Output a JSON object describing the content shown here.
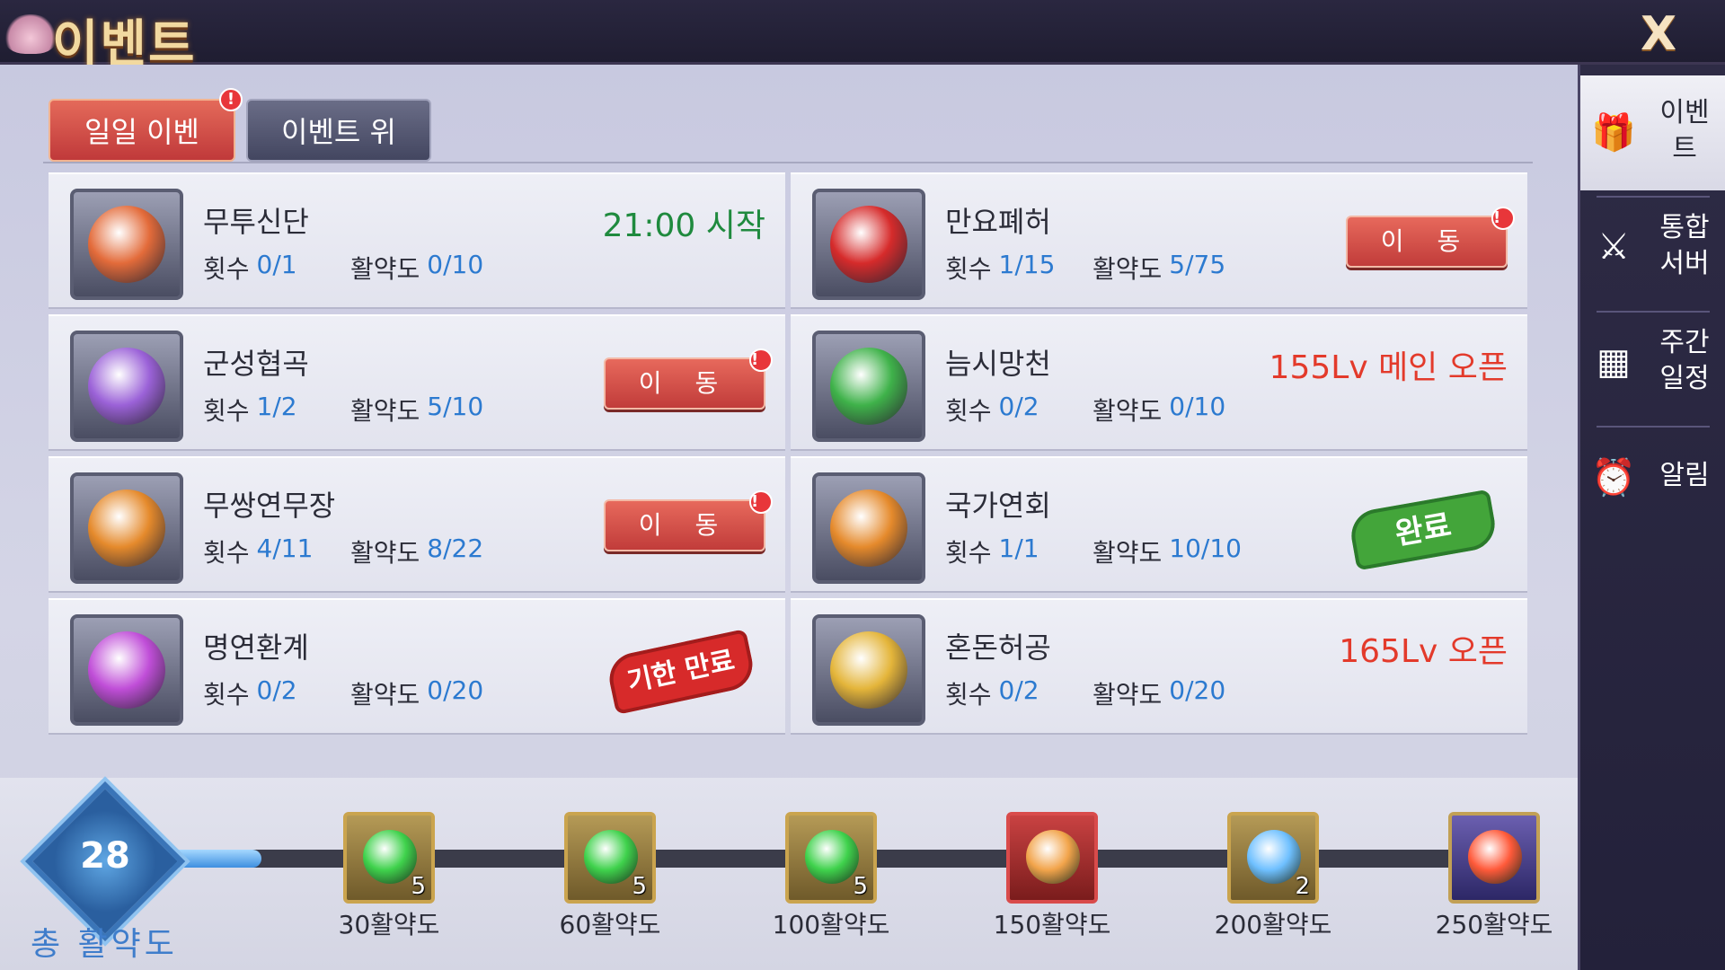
{
  "header": {
    "title": "이벤트",
    "close_label": "X"
  },
  "tabs": [
    {
      "label": "일일 이벤트",
      "badge": "!"
    },
    {
      "label": "이벤트 위탁"
    }
  ],
  "labels": {
    "count": "횟수",
    "activity": "활약도"
  },
  "events": [
    {
      "name": "무투신단",
      "count": "0/1",
      "activity": "0/10",
      "status": "21:00 시작",
      "status_type": "green",
      "icon": "crystal-fire-icon",
      "color": "#e36b3a"
    },
    {
      "name": "만요폐허",
      "count": "1/15",
      "activity": "5/75",
      "status": "이 동",
      "status_type": "button",
      "badge": "!",
      "icon": "phoenix-icon",
      "color": "#d62b2b"
    },
    {
      "name": "군성협곡",
      "count": "1/2",
      "activity": "5/10",
      "status": "이 동",
      "status_type": "button",
      "badge": "!",
      "icon": "paw-orb-icon",
      "color": "#9b62d8"
    },
    {
      "name": "늠시망천",
      "count": "0/2",
      "activity": "0/10",
      "status": "155Lv 메인 오픈",
      "status_type": "red",
      "icon": "green-orb-icon",
      "color": "#3fb24a"
    },
    {
      "name": "무쌍연무장",
      "count": "4/11",
      "activity": "8/22",
      "status": "이 동",
      "status_type": "button",
      "badge": "!",
      "icon": "crest-icon",
      "color": "#e58a2c"
    },
    {
      "name": "국가연회",
      "count": "1/1",
      "activity": "10/10",
      "status": "완료",
      "status_type": "done",
      "icon": "crest-icon",
      "color": "#e58a2c"
    },
    {
      "name": "명연환계",
      "count": "0/2",
      "activity": "0/20",
      "status": "기한 만료",
      "status_type": "expired",
      "icon": "purple-egg-icon",
      "color": "#c04ed8"
    },
    {
      "name": "혼돈허공",
      "count": "0/2",
      "activity": "0/20",
      "status": "165Lv 오픈",
      "status_type": "red",
      "icon": "exp-icon",
      "color": "#e4b53a"
    }
  ],
  "progress": {
    "total_label": "총 활약도",
    "value": "28",
    "fill_fraction": 0.112,
    "rewards": [
      {
        "label": "30활약도",
        "count": "5",
        "icon": "green-gem-icon",
        "style": "gold"
      },
      {
        "label": "60활약도",
        "count": "5",
        "icon": "green-gem-icon",
        "style": "gold"
      },
      {
        "label": "100활약도",
        "count": "5",
        "icon": "green-gem-icon",
        "style": "gold"
      },
      {
        "label": "150활약도",
        "count": "",
        "icon": "scroll-icon",
        "style": "red"
      },
      {
        "label": "200활약도",
        "count": "2",
        "icon": "book-orb-icon",
        "style": "gold"
      },
      {
        "label": "250활약도",
        "count": "",
        "icon": "card-icon",
        "style": "purple"
      }
    ]
  },
  "sidenav": [
    {
      "label": "이벤\n트",
      "icon": "event-icon",
      "glyph": "🎁",
      "active": true
    },
    {
      "label": "통합\n서버",
      "icon": "crossed-swords-icon",
      "glyph": "⚔"
    },
    {
      "label": "주간\n일정",
      "icon": "calendar-icon",
      "glyph": "▦"
    },
    {
      "label": "알림",
      "icon": "alarm-clock-icon",
      "glyph": "⏰"
    }
  ]
}
